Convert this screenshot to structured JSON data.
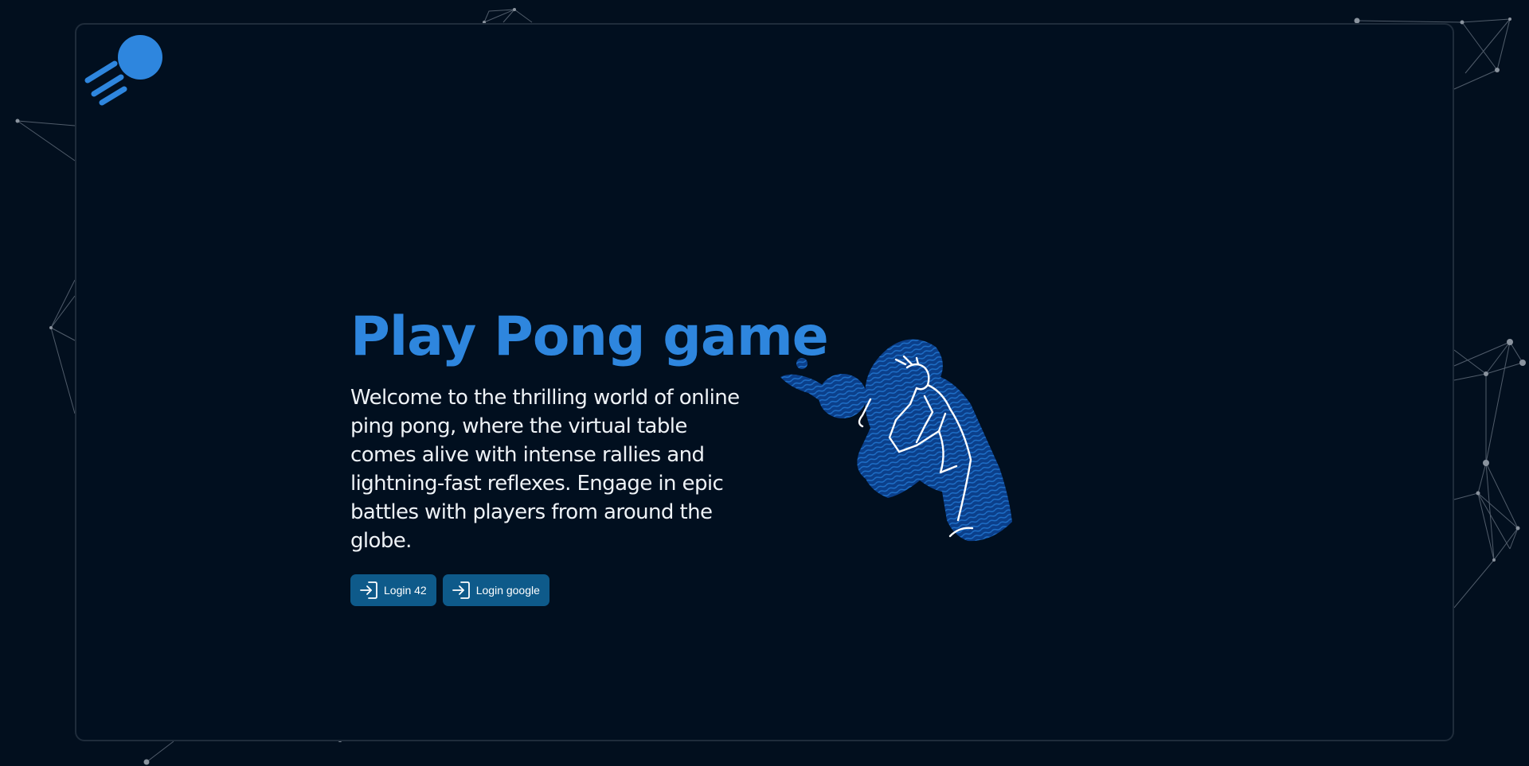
{
  "hero": {
    "title": "Play Pong game",
    "description": "Welcome to the thrilling world of online ping pong, where the virtual table comes alive with intense rallies and lightning-fast reflexes. Engage in epic battles with players from around the globe."
  },
  "actions": {
    "login_42_label": "Login 42",
    "login_google_label": "Login google",
    "login_icon": "login-icon"
  },
  "brand": {
    "logo_icon": "ping-pong-ball-logo",
    "accent_color": "#2e86de",
    "button_color": "#0e5a8a",
    "background_color": "#010f1f"
  },
  "illustration": {
    "icon": "table-tennis-player"
  }
}
